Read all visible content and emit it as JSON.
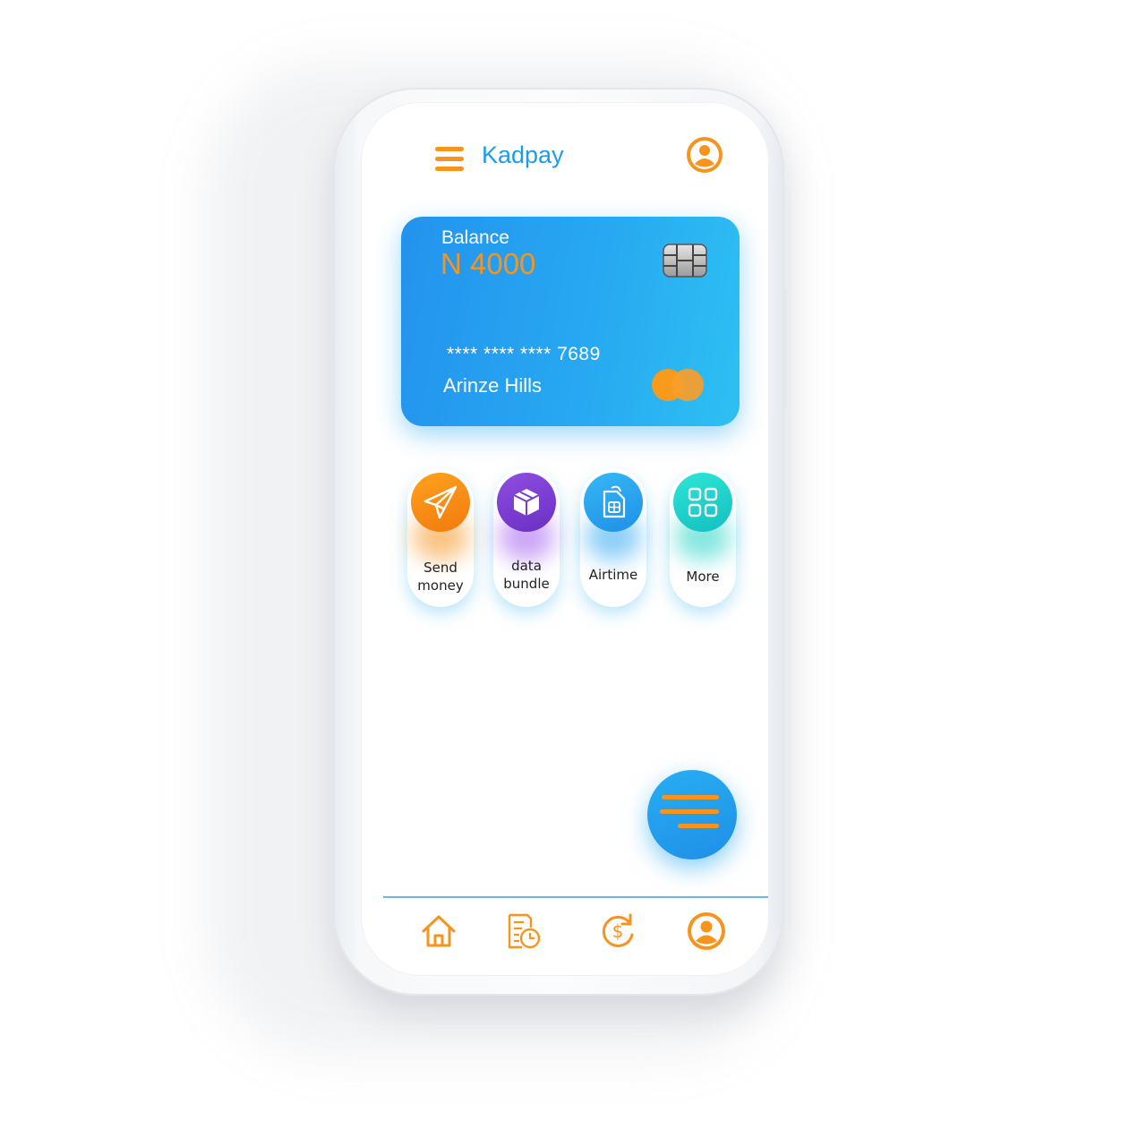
{
  "app": {
    "title": "Kadpay",
    "accent_color": "#f7941d",
    "brand_color": "#1e9ce9"
  },
  "header": {
    "menu_icon": "hamburger-menu-icon",
    "profile_icon": "user-avatar-icon"
  },
  "card": {
    "balance_label": "Balance",
    "balance_amount": "N 4000",
    "card_number": "**** **** **** 7689",
    "card_holder": "Arinze Hills",
    "chip_icon": "sim-chip-icon",
    "network_icon": "mastercard-logo"
  },
  "actions": [
    {
      "label_line1": "Send",
      "label_line2": "money",
      "icon": "paper-plane-icon",
      "color": "#f7941d"
    },
    {
      "label_line1": "data",
      "label_line2": "bundle",
      "icon": "package-box-icon",
      "color": "#7a3bd0"
    },
    {
      "label_line1": "Airtime",
      "label_line2": "",
      "icon": "sim-card-icon",
      "color": "#2fa8f2"
    },
    {
      "label_line1": "More",
      "label_line2": "",
      "icon": "grid-apps-icon",
      "color": "#22d3c7"
    }
  ],
  "fab": {
    "icon": "menu-lines-icon"
  },
  "bottom_nav": [
    {
      "name": "home",
      "icon": "home-icon"
    },
    {
      "name": "history",
      "icon": "history-document-icon"
    },
    {
      "name": "transfer",
      "icon": "dollar-refresh-icon"
    },
    {
      "name": "profile",
      "icon": "user-avatar-icon"
    }
  ]
}
